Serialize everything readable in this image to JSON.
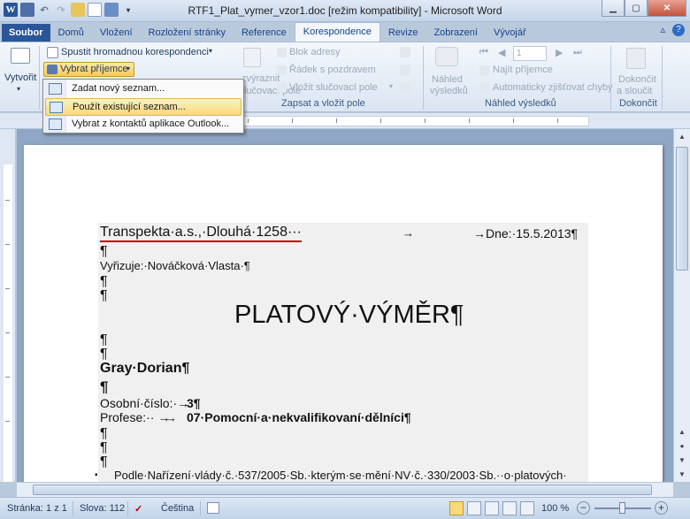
{
  "window": {
    "title": "RTF1_Plat_vymer_vzor1.doc [režim kompatibility] - Microsoft Word",
    "app_icon_letter": "W"
  },
  "tabs": [
    "Soubor",
    "Domů",
    "Vložení",
    "Rozložení stránky",
    "Reference",
    "Korespondence",
    "Revize",
    "Zobrazení",
    "Vývojář"
  ],
  "ribbon": {
    "vytvorit": "Vytvořit",
    "spustit": "Spustit hromadnou korespondenci",
    "vybrat": "Vybrat příjemce",
    "zvyraznit": "zvýraznit",
    "slucovaci_pole": "lučovací pole",
    "blok_adresy": "Blok adresy",
    "radek_pozdravem": "Řádek s pozdravem",
    "vlozit_pole": "Vložit slučovací pole",
    "group_zapsat": "Zapsat a vložit pole",
    "nahled": "Náhled",
    "vysledku": "výsledků",
    "record_number": "1",
    "najit": "Najít příjemce",
    "autochyby": "Automaticky zjišťovat chyby",
    "group_nahled": "Náhled výsledků",
    "dokoncit": "Dokončit",
    "a_sloucit": "a sloučit",
    "group_dokonceni": "Dokončit"
  },
  "menu": {
    "items": [
      "Zadat nový seznam...",
      "Použít existující seznam...",
      "Vybrat z kontaktů aplikace Outlook..."
    ]
  },
  "document": {
    "header_left": "Transpekta·a.s.,·Dlouhá·1258···",
    "header_arrow": "→",
    "header_right": "→Dne:·15.5.2013¶",
    "pilcrow": "¶",
    "vyrizuje": "Vyřizuje:·Nováčková·Vlasta·¶",
    "title": "PLATOVÝ·VÝMĚR¶",
    "name": "Gray·Dorian¶",
    "osobni_label": "Osobní·číslo:·→",
    "osobni_value": "3¶",
    "profese_label": "Profese:··  →   ",
    "profese_value": "07·Pomocní·a·nekvalifikovaní·dělníci¶",
    "bullet_text": "Podle·Nařízení·vlády·č.·537/2005·Sb.·kterým·se·mění·NV·č.·330/2003·Sb.··o·platových·"
  },
  "statusbar": {
    "page": "Stránka: 1 z 1",
    "words": "Slova: 112",
    "language": "Čeština",
    "zoom": "100 %"
  }
}
